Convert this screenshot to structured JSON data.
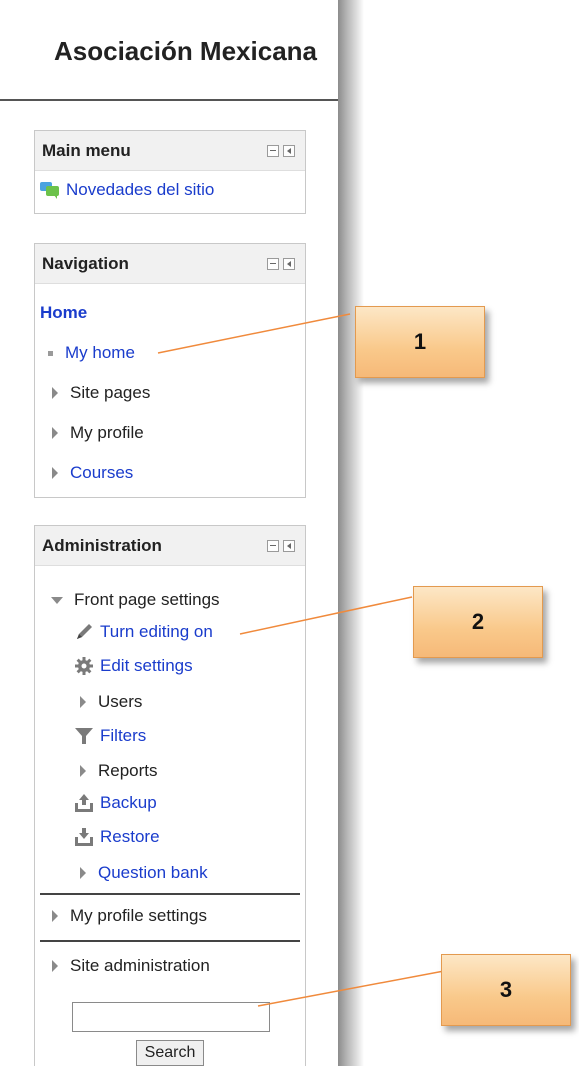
{
  "site": {
    "title": "Asociación Mexicana"
  },
  "main_menu": {
    "title": "Main menu",
    "items": [
      {
        "label": "Novedades del sitio",
        "icon": "forum-icon"
      }
    ]
  },
  "navigation": {
    "title": "Navigation",
    "home": "Home",
    "items": [
      {
        "label": "My home"
      },
      {
        "label": "Site pages"
      },
      {
        "label": "My profile"
      },
      {
        "label": "Courses"
      }
    ]
  },
  "administration": {
    "title": "Administration",
    "front_page": "Front page settings",
    "items": [
      {
        "label": "Turn editing on",
        "icon": "pencil-icon"
      },
      {
        "label": "Edit settings",
        "icon": "gear-icon"
      },
      {
        "label": "Users",
        "icon": "arrow-right-icon"
      },
      {
        "label": "Filters",
        "icon": "filter-icon"
      },
      {
        "label": "Reports",
        "icon": "arrow-right-icon"
      },
      {
        "label": "Backup",
        "icon": "upload-icon"
      },
      {
        "label": "Restore",
        "icon": "download-icon"
      },
      {
        "label": "Question bank",
        "icon": "arrow-right-icon"
      }
    ],
    "my_profile_settings": "My profile settings",
    "site_administration": "Site administration",
    "search": {
      "value": "",
      "button": "Search"
    }
  },
  "callouts": [
    "1",
    "2",
    "3"
  ],
  "colors": {
    "link": "#1a3ccc",
    "callout": "#f9c98b",
    "leader": "#f08a3c"
  }
}
